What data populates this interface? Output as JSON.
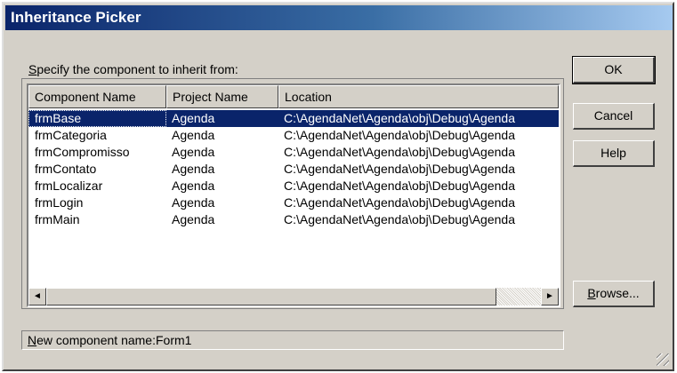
{
  "window": {
    "title": "Inheritance Picker"
  },
  "prompt": {
    "first_char": "S",
    "rest": "pecify the component to inherit from:"
  },
  "list": {
    "columns": [
      "Component Name",
      "Project Name",
      "Location"
    ],
    "rows": [
      [
        "frmBase",
        "Agenda",
        "C:\\AgendaNet\\Agenda\\obj\\Debug\\Agenda"
      ],
      [
        "frmCategoria",
        "Agenda",
        "C:\\AgendaNet\\Agenda\\obj\\Debug\\Agenda"
      ],
      [
        "frmCompromisso",
        "Agenda",
        "C:\\AgendaNet\\Agenda\\obj\\Debug\\Agenda"
      ],
      [
        "frmContato",
        "Agenda",
        "C:\\AgendaNet\\Agenda\\obj\\Debug\\Agenda"
      ],
      [
        "frmLocalizar",
        "Agenda",
        "C:\\AgendaNet\\Agenda\\obj\\Debug\\Agenda"
      ],
      [
        "frmLogin",
        "Agenda",
        "C:\\AgendaNet\\Agenda\\obj\\Debug\\Agenda"
      ],
      [
        "frmMain",
        "Agenda",
        "C:\\AgendaNet\\Agenda\\obj\\Debug\\Agenda"
      ]
    ],
    "selected_index": 0,
    "scroll_left_glyph": "◄",
    "scroll_right_glyph": "►"
  },
  "buttons": {
    "ok": "OK",
    "cancel": "Cancel",
    "help": "Help",
    "browse_first_char": "B",
    "browse_rest": "rowse..."
  },
  "status": {
    "first_char": "N",
    "rest": "ew component name:Form1"
  },
  "colors": {
    "face": "#d4d0c8",
    "title_start": "#0a246a",
    "selection": "#0a246a"
  }
}
